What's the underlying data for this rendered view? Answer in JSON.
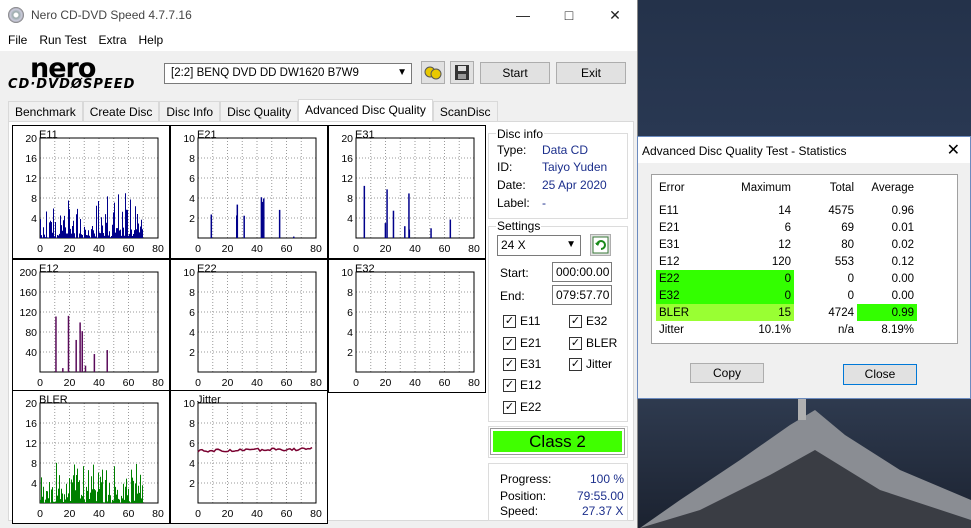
{
  "window": {
    "title": "Nero CD-DVD Speed 4.7.7.16",
    "minimize": "—",
    "maximize": "□",
    "close": "✕"
  },
  "menu": [
    "File",
    "Run Test",
    "Extra",
    "Help"
  ],
  "logo": {
    "top": "nero",
    "bottom": "CD·DVDØSPEED"
  },
  "toolbar": {
    "drive": "[2:2]   BENQ DVD DD DW1620 B7W9",
    "start_label": "Start",
    "exit_label": "Exit"
  },
  "tabs": [
    "Benchmark",
    "Create Disc",
    "Disc Info",
    "Disc Quality",
    "Advanced Disc Quality",
    "ScanDisc"
  ],
  "active_tab": 4,
  "disc_info": {
    "header": "Disc info",
    "type_label": "Type:",
    "type": "Data CD",
    "id_label": "ID:",
    "id": "Taiyo Yuden",
    "date_label": "Date:",
    "date": "25 Apr 2020",
    "label_label": "Label:",
    "label": "-"
  },
  "settings": {
    "header": "Settings",
    "speed": "24 X",
    "start_label": "Start:",
    "start": "000:00.00",
    "end_label": "End:",
    "end": "079:57.70",
    "checks": [
      "E11",
      "E32",
      "E21",
      "BLER",
      "E31",
      "Jitter",
      "E12",
      "E22"
    ]
  },
  "class": "Class 2",
  "progress": {
    "progress_label": "Progress:",
    "progress": "100 %",
    "position_label": "Position:",
    "position": "79:55.00",
    "speed_label": "Speed:",
    "speed": "27.37 X"
  },
  "charts": [
    {
      "name": "E11",
      "yticks": [
        "20",
        "16",
        "12",
        "8",
        "4"
      ],
      "xticks": [
        "0",
        "20",
        "40",
        "60",
        "80"
      ],
      "color": "#00008b",
      "kind": "dense"
    },
    {
      "name": "E21",
      "yticks": [
        "10",
        "8",
        "6",
        "4",
        "2"
      ],
      "xticks": [
        "0",
        "20",
        "40",
        "60",
        "80"
      ],
      "color": "#00008b",
      "kind": "sparse"
    },
    {
      "name": "E31",
      "yticks": [
        "20",
        "16",
        "12",
        "8",
        "4"
      ],
      "xticks": [
        "0",
        "20",
        "40",
        "60",
        "80"
      ],
      "color": "#00008b",
      "kind": "sparse"
    },
    {
      "name": "E12",
      "yticks": [
        "200",
        "160",
        "120",
        "80",
        "40"
      ],
      "xticks": [
        "0",
        "20",
        "40",
        "60",
        "80"
      ],
      "color": "#5a0a5a",
      "kind": "sparse"
    },
    {
      "name": "E22",
      "yticks": [
        "10",
        "8",
        "6",
        "4",
        "2"
      ],
      "xticks": [
        "0",
        "20",
        "40",
        "60",
        "80"
      ],
      "color": "#00008b",
      "kind": "empty"
    },
    {
      "name": "E32",
      "yticks": [
        "10",
        "8",
        "6",
        "4",
        "2"
      ],
      "xticks": [
        "0",
        "20",
        "40",
        "60",
        "80"
      ],
      "color": "#00008b",
      "kind": "empty"
    },
    {
      "name": "BLER",
      "yticks": [
        "20",
        "16",
        "12",
        "8",
        "4"
      ],
      "xticks": [
        "0",
        "20",
        "40",
        "60",
        "80"
      ],
      "color": "#008000",
      "kind": "dense"
    },
    {
      "name": "Jitter",
      "yticks": [
        "10",
        "8",
        "6",
        "4",
        "2"
      ],
      "xticks": [
        "0",
        "20",
        "40",
        "60",
        "80"
      ],
      "color": "#7a0030",
      "kind": "line"
    }
  ],
  "stats": {
    "title": "Advanced Disc Quality Test - Statistics",
    "headers": [
      "Error",
      "Maximum",
      "Total",
      "Average"
    ],
    "rows": [
      {
        "error": "E11",
        "max": "14",
        "total": "4575",
        "avg": "0.96"
      },
      {
        "error": "E21",
        "max": "6",
        "total": "69",
        "avg": "0.01"
      },
      {
        "error": "E31",
        "max": "12",
        "total": "80",
        "avg": "0.02"
      },
      {
        "error": "E12",
        "max": "120",
        "total": "553",
        "avg": "0.12"
      },
      {
        "error": "E22",
        "max": "0",
        "total": "0",
        "avg": "0.00"
      },
      {
        "error": "E32",
        "max": "0",
        "total": "0",
        "avg": "0.00"
      },
      {
        "error": "BLER",
        "max": "15",
        "total": "4724",
        "avg": "0.99"
      },
      {
        "error": "Jitter",
        "max": "10.1%",
        "total": "n/a",
        "avg": "8.19%"
      }
    ],
    "copy_label": "Copy",
    "close_label": "Close",
    "highlight_color": "#33ff00",
    "bler_color": "#99ff33"
  }
}
